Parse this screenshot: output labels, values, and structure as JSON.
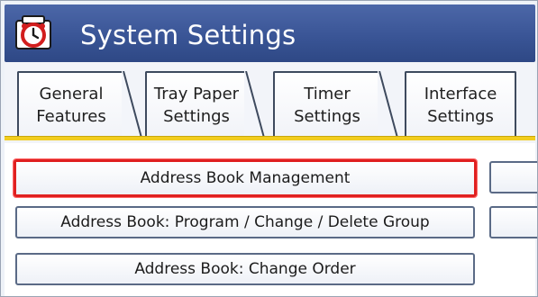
{
  "window": {
    "title": "System Settings",
    "icon": "system-settings-icon"
  },
  "tabs": [
    {
      "label": "General\nFeatures"
    },
    {
      "label": "Tray Paper\nSettings"
    },
    {
      "label": "Timer\nSettings"
    },
    {
      "label": "Interface\nSettings"
    }
  ],
  "buttons": [
    {
      "label": "Address Book Management",
      "selected": true
    },
    {
      "label": "Address Book: Program / Change / Delete Group",
      "selected": false
    },
    {
      "label": "Address Book: Change Order",
      "selected": false
    }
  ],
  "colors": {
    "titlebar": "#3a5596",
    "tab_underline": "#f2cd1e",
    "selection_border": "#e02020"
  }
}
